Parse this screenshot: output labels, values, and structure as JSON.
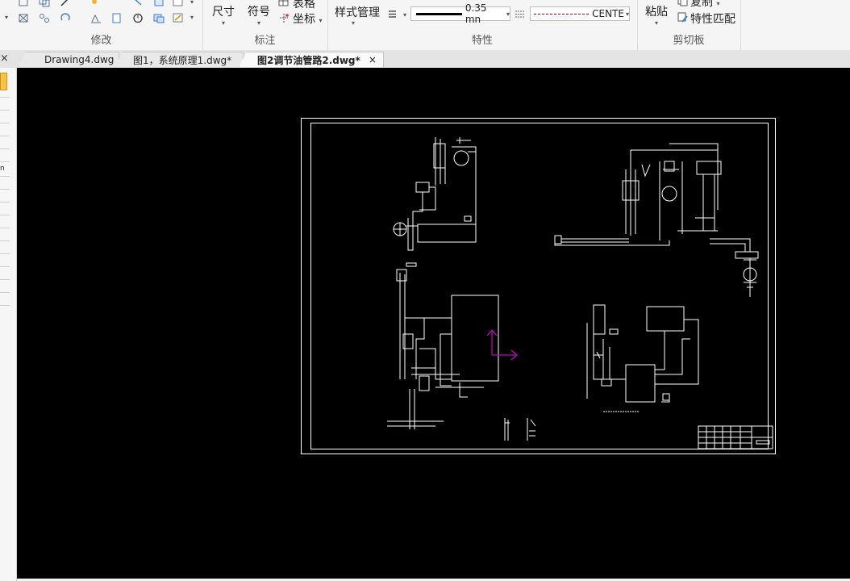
{
  "ribbon": {
    "modify_group_label": "修改",
    "annotation_group": {
      "label": "标注",
      "dimension_label": "尺寸",
      "symbol_label": "符号",
      "table_label": "表格",
      "coordinate_label": "坐标"
    },
    "properties_group": {
      "label": "特性",
      "style_manager_label": "样式管理",
      "lineweight_value": "0.35 mn",
      "linetype_value": "CENTE"
    },
    "clipboard_group": {
      "label": "剪切板",
      "paste_label": "粘贴",
      "copy_label": "复制",
      "match_properties_label": "特性匹配"
    }
  },
  "tabs": [
    {
      "label": "Drawing4.dwg",
      "active": false
    },
    {
      "label": "图1，系统原理1.dwg*",
      "active": false
    },
    {
      "label": "图2调节油管路2.dwg*",
      "active": true
    }
  ],
  "tab_close_glyph": "×",
  "left_strip": {
    "input_fragment": "n"
  },
  "canvas": {
    "background": "#000000",
    "ucs_color": "#c000c0",
    "line_color": "#ffffff"
  }
}
